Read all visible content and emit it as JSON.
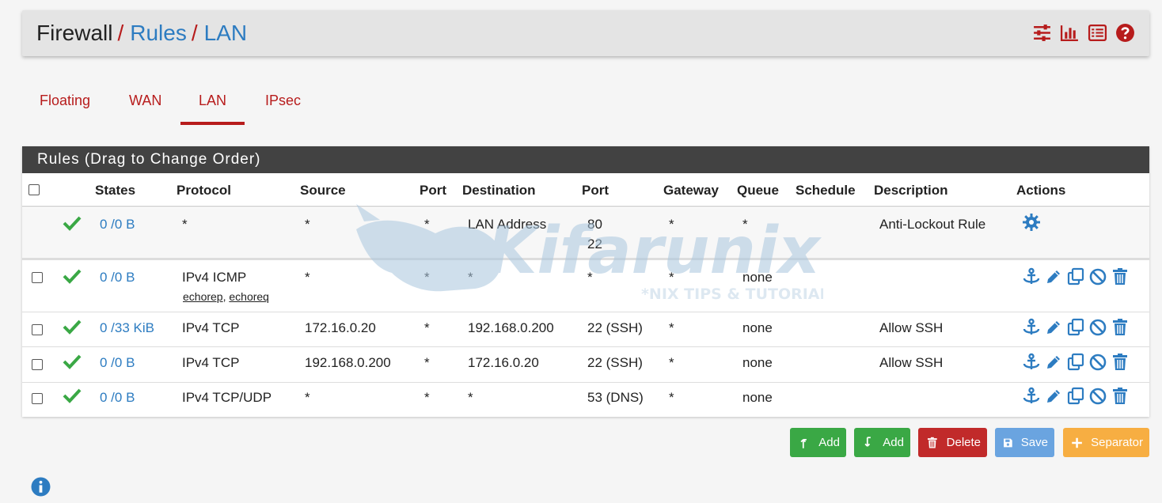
{
  "breadcrumb": {
    "first": "Firewall",
    "second": "Rules",
    "third": "LAN",
    "separator": "/"
  },
  "header_icons": [
    "sliders-icon",
    "chart-bar-icon",
    "list-icon",
    "help-icon"
  ],
  "tabs": [
    {
      "label": "Floating"
    },
    {
      "label": "WAN"
    },
    {
      "label": "LAN",
      "active": true
    },
    {
      "label": "IPsec"
    }
  ],
  "panel": {
    "title": "Rules (Drag to Change Order)"
  },
  "columns": {
    "states": "States",
    "protocol": "Protocol",
    "source": "Source",
    "port": "Port",
    "destination": "Destination",
    "dport": "Port",
    "gateway": "Gateway",
    "queue": "Queue",
    "schedule": "Schedule",
    "description": "Description",
    "actions": "Actions"
  },
  "rows": [
    {
      "states": "0 /0 B",
      "protocol": "*",
      "source": "*",
      "port": "*",
      "destination": "LAN Address",
      "dport": "80",
      "dport2": "22",
      "gateway": "*",
      "queue": "*",
      "schedule": "",
      "description": "Anti-Lockout Rule"
    },
    {
      "states": "0 /0 B",
      "protocol": "IPv4 ICMP",
      "sub1": "echorep",
      "sub_sep": ",",
      "sub2": "echoreq",
      "source": "*",
      "port": "*",
      "destination": "*",
      "dport": "*",
      "gateway": "*",
      "queue": "none",
      "schedule": "",
      "description": ""
    },
    {
      "states": "0 /33 KiB",
      "protocol": "IPv4 TCP",
      "source": "172.16.0.20",
      "port": "*",
      "destination": "192.168.0.200",
      "dport": "22 (SSH)",
      "gateway": "*",
      "queue": "none",
      "schedule": "",
      "description": "Allow SSH"
    },
    {
      "states": "0 /0 B",
      "protocol": "IPv4 TCP",
      "source": "192.168.0.200",
      "port": "*",
      "destination": "172.16.0.20",
      "dport": "22 (SSH)",
      "gateway": "*",
      "queue": "none",
      "schedule": "",
      "description": "Allow SSH"
    },
    {
      "states": "0 /0 B",
      "protocol": "IPv4 TCP/UDP",
      "source": "*",
      "port": "*",
      "destination": "*",
      "dport": "53 (DNS)",
      "gateway": "*",
      "queue": "none",
      "schedule": "",
      "description": ""
    }
  ],
  "watermark": {
    "brand": "Kifarunix",
    "tagline": "*NIX TIPS & TUTORIALS"
  },
  "buttons": {
    "add_top": "Add",
    "add_bottom": "Add",
    "delete": "Delete",
    "save": "Save",
    "separator": "Separator"
  },
  "colors": {
    "accent_red": "#b71c1c",
    "link_blue": "#2d7cc1",
    "pass_green": "#3aa845",
    "btn_blue": "#6aa4e0",
    "btn_orange": "#f7ae42",
    "heading_dark": "#424242"
  }
}
